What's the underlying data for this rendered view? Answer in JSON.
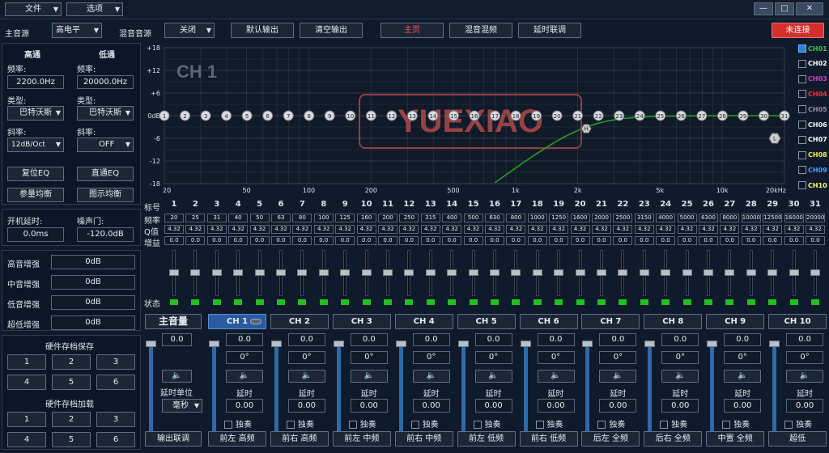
{
  "menu": {
    "file": "文件",
    "options": "选项"
  },
  "titlebar": {
    "minimize": "—",
    "maximize": "□",
    "close": "✕"
  },
  "toolbar": {
    "main_source_label": "主音源",
    "main_source_value": "高电平",
    "mix_source_label": "混音音源",
    "mix_source_value": "关闭",
    "default_output": "默认输出",
    "clear_output": "清空输出",
    "home": "主页",
    "mix": "混音混频",
    "delay": "延时联调",
    "connection": "未连接"
  },
  "left": {
    "hp_title": "高通",
    "lp_title": "低通",
    "freq_label": "频率:",
    "hp_freq": "2200.0Hz",
    "lp_freq": "20000.0Hz",
    "type_label": "类型:",
    "hp_type": "巴特沃斯",
    "lp_type": "巴特沃斯",
    "slope_label": "斜率:",
    "hp_slope": "12dB/Oct",
    "lp_slope": "OFF",
    "reset_eq": "复位EQ",
    "direct_eq": "直通EQ",
    "param_eq": "参量均衡",
    "graphic_eq": "图示均衡",
    "power_delay_label": "开机延时:",
    "power_delay": "0.0ms",
    "noise_gate_label": "噪声门:",
    "noise_gate": "-120.0dB",
    "enh": [
      {
        "label": "高音增强",
        "value": "0dB"
      },
      {
        "label": "中音增强",
        "value": "0dB"
      },
      {
        "label": "低音增强",
        "value": "0dB"
      },
      {
        "label": "超低增强",
        "value": "0dB"
      }
    ],
    "save_title": "硬件存档保存",
    "load_title": "硬件存档加载",
    "slots": [
      "1",
      "2",
      "3",
      "4",
      "5",
      "6"
    ]
  },
  "graph": {
    "channel": "CH 1",
    "watermark": "YUEXIAO",
    "y_ticks": [
      "+18",
      "+12",
      "+6",
      "0dB",
      "-6",
      "-12",
      "-18"
    ],
    "x_ticks": [
      "20",
      "50",
      "100",
      "200",
      "500",
      "1k",
      "2k",
      "5k",
      "10k",
      "20kHz"
    ],
    "hp_marker": "H",
    "lp_marker": "L",
    "bands": [
      "1",
      "2",
      "3",
      "4",
      "5",
      "6",
      "7",
      "8",
      "9",
      "10",
      "11",
      "12",
      "13",
      "14",
      "15",
      "16",
      "17",
      "18",
      "19",
      "20",
      "21",
      "22",
      "23",
      "24",
      "25",
      "26",
      "27",
      "28",
      "29",
      "30",
      "31"
    ],
    "curve": {
      "type": "highpass",
      "freq_hz": 2200,
      "slope": "12dB/Oct"
    }
  },
  "ch_list": [
    {
      "name": "CH01",
      "color": "#2ecc40",
      "checked": true
    },
    {
      "name": "CH02",
      "color": "#ffffff",
      "checked": false
    },
    {
      "name": "CH03",
      "color": "#d040d0",
      "checked": false
    },
    {
      "name": "CH04",
      "color": "#ff3030",
      "checked": false
    },
    {
      "name": "CH05",
      "color": "#a088a0",
      "checked": false
    },
    {
      "name": "CH06",
      "color": "#e8f4ff",
      "checked": false
    },
    {
      "name": "CH07",
      "color": "#ffffff",
      "checked": false
    },
    {
      "name": "CH08",
      "color": "#f0f040",
      "checked": false
    },
    {
      "name": "CH09",
      "color": "#40a0ff",
      "checked": false
    },
    {
      "name": "CH10",
      "color": "#ffff60",
      "checked": false
    }
  ],
  "eq": {
    "band_label": "标号",
    "freq_label": "频率",
    "q_label": "Q值",
    "gain_label": "增益",
    "state_label": "状态",
    "freqs": [
      "20",
      "25",
      "31",
      "40",
      "50",
      "63",
      "80",
      "100",
      "125",
      "160",
      "200",
      "250",
      "315",
      "400",
      "500",
      "630",
      "800",
      "1000",
      "1250",
      "1600",
      "2000",
      "2500",
      "3150",
      "4000",
      "5000",
      "6300",
      "8000",
      "10000",
      "12500",
      "16000",
      "20000"
    ],
    "q": "4.32",
    "gain": "0.0"
  },
  "master": {
    "title": "主音量",
    "value": "0.0",
    "delay_unit_label": "延时单位",
    "delay_unit": "毫秒",
    "output_link": "输出联调"
  },
  "channels": [
    {
      "name": "CH 1",
      "out": "前左 高频"
    },
    {
      "name": "CH 2",
      "out": "前右 高频"
    },
    {
      "name": "CH 3",
      "out": "前左 中频"
    },
    {
      "name": "CH 4",
      "out": "前右 中频"
    },
    {
      "name": "CH 5",
      "out": "前左 低频"
    },
    {
      "name": "CH 6",
      "out": "前右 低频"
    },
    {
      "name": "CH 7",
      "out": "后左 全频"
    },
    {
      "name": "CH 8",
      "out": "后右 全频"
    },
    {
      "name": "CH 9",
      "out": "中置 全频"
    },
    {
      "name": "CH 10",
      "out": "超低"
    }
  ],
  "ch_common": {
    "vol": "0.0",
    "phase": "0°",
    "delay_label": "延时",
    "delay": "0.00",
    "solo": "独奏"
  },
  "theme": {
    "bg": "#0f1a2c",
    "active": "#2a5aa0",
    "accent_red": "#e53935",
    "curve": "#21a021"
  }
}
